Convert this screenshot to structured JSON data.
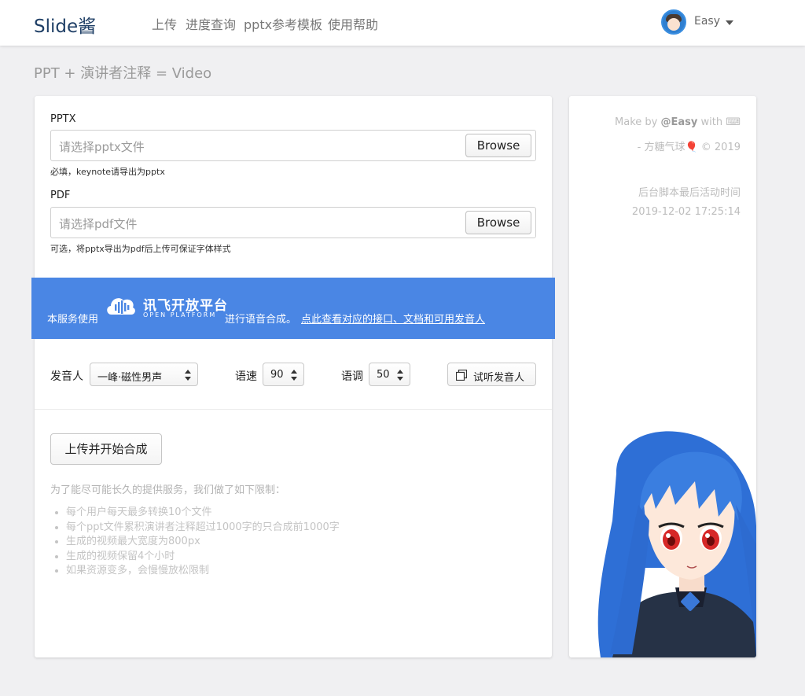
{
  "navbar": {
    "brand": "Slide酱",
    "items": [
      "上传",
      "进度查询",
      "pptx参考模板",
      "使用帮助"
    ],
    "user": "Easy"
  },
  "subtitle": "PPT + 演讲者注释 = Video",
  "form": {
    "pptx": {
      "label": "PPTX",
      "placeholder": "请选择pptx文件",
      "button": "Browse",
      "hint": "必填，keynote请导出为pptx"
    },
    "pdf": {
      "label": "PDF",
      "placeholder": "请选择pdf文件",
      "button": "Browse",
      "hint": "可选，将pptx导出为pdf后上传可保证字体样式"
    }
  },
  "banner": {
    "prefix": "本服务使用",
    "logo_title": "讯飞开放平台",
    "logo_sub": "OPEN PLATFORM",
    "middle": "进行语音合成。",
    "link": "点此查看对应的接口、文档和可用发音人",
    "color": "#4a86e4"
  },
  "settings": {
    "speaker_label": "发音人",
    "speaker_value": "一峰·磁性男声",
    "speed_label": "语速",
    "speed_value": "90",
    "pitch_label": "语调",
    "pitch_value": "50",
    "listen_button": "试听发音人"
  },
  "submit_button": "上传并开始合成",
  "limits": {
    "title": "为了能尽可能长久的提供服务，我们做了如下限制：",
    "items": [
      "每个用户每天最多转换10个文件",
      "每个ppt文件累积演讲者注释超过1000字的只合成前1000字",
      "生成的视频最大宽度为800px",
      "生成的视频保留4个小时",
      "如果资源变多，会慢慢放松限制"
    ]
  },
  "side": {
    "make_by_pre": "Make by ",
    "make_by_name": "@Easy",
    "make_by_post": " with ⌨",
    "credit_pre": "- 方糖气球",
    "credit_balloon": "🎈",
    "credit_post": " © 2019",
    "status_label": "后台脚本最后活动时间",
    "status_time": "2019-12-02 17:25:14"
  }
}
